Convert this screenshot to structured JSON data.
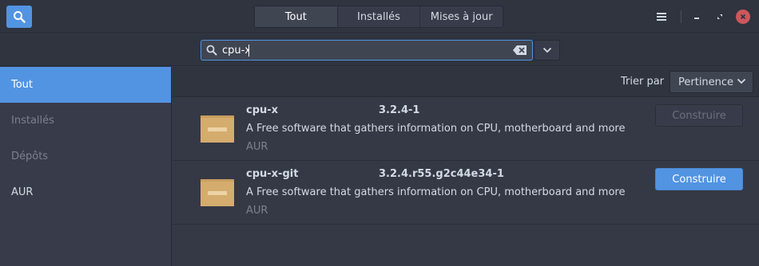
{
  "header": {
    "tabs": [
      {
        "label": "Tout"
      },
      {
        "label": "Installés"
      },
      {
        "label": "Mises à jour"
      }
    ],
    "icons": [
      "search-icon",
      "hamburger-menu-icon",
      "minimize-icon",
      "maximize-icon",
      "close-icon"
    ]
  },
  "search": {
    "value": "cpu-x",
    "accent_color": "#5294e2"
  },
  "sidebar": {
    "items": [
      {
        "label": "Tout"
      },
      {
        "label": "Installés"
      },
      {
        "label": "Dépôts"
      },
      {
        "label": "AUR"
      }
    ]
  },
  "sort": {
    "label": "Trier par",
    "selected": "Pertinence"
  },
  "packages": [
    {
      "name": "cpu-x",
      "version": "3.2.4-1",
      "description": "A Free software that gathers information on CPU, motherboard and more",
      "repo": "AUR",
      "action": "Construire"
    },
    {
      "name": "cpu-x-git",
      "version": "3.2.4.r55.g2c44e34-1",
      "description": "A Free software that gathers information on CPU, motherboard and more",
      "repo": "AUR",
      "action": "Construire"
    }
  ],
  "colors": {
    "accent": "#5294e2",
    "close_button": "#cc575d",
    "package_icon": "#d4ac6e"
  }
}
